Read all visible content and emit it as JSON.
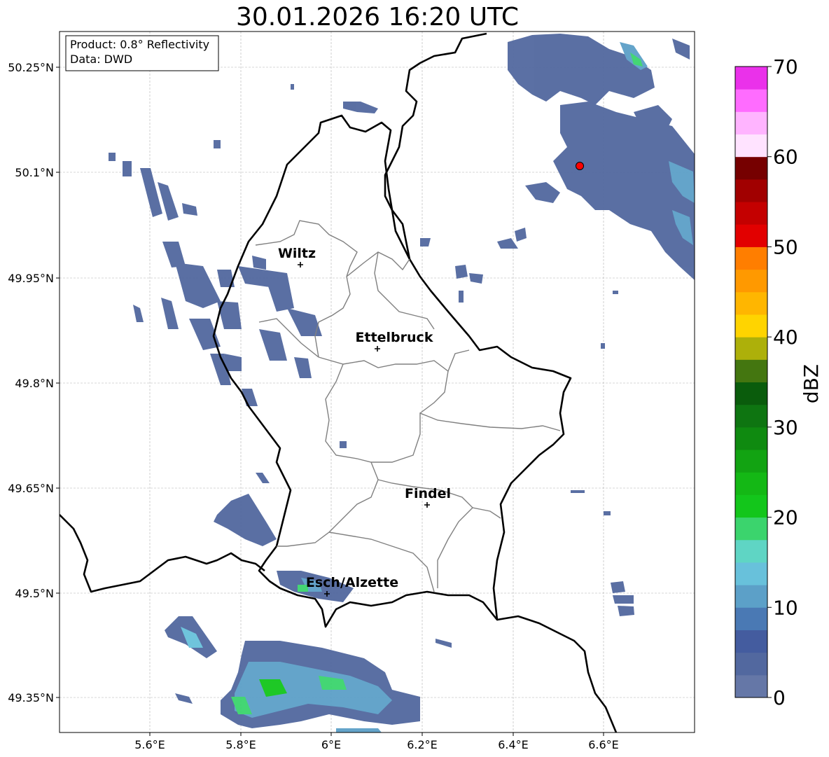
{
  "title": "30.01.2026 16:20 UTC",
  "info_box": {
    "product": "Product: 0.8° Reflectivity",
    "data": "Data: DWD"
  },
  "lat_labels": [
    "50.25°N",
    "50.1°N",
    "49.95°N",
    "49.8°N",
    "49.65°N",
    "49.5°N",
    "49.35°N"
  ],
  "lon_labels": [
    "5.6°E",
    "5.8°E",
    "6°E",
    "6.2°E",
    "6.4°E",
    "6.6°E"
  ],
  "cities": [
    {
      "name": "Wiltz",
      "lon": 5.935,
      "lat": 49.966
    },
    {
      "name": "Ettelbruck",
      "lon": 6.103,
      "lat": 49.848
    },
    {
      "name": "Findel",
      "lon": 6.213,
      "lat": 49.626
    },
    {
      "name": "Esch/Alzette",
      "lon": 5.981,
      "lat": 49.497
    }
  ],
  "radar_site": {
    "lon": 6.548,
    "lat": 50.109
  },
  "colorbar": {
    "label": "dBZ",
    "ticks": [
      "0",
      "10",
      "20",
      "30",
      "40",
      "50",
      "60",
      "70"
    ],
    "colors": [
      "#6577a7",
      "#52689f",
      "#445c9f",
      "#4a79b4",
      "#5ca0c8",
      "#68c1db",
      "#5fd5c4",
      "#3bd46d",
      "#13c61b",
      "#14b815",
      "#12a312",
      "#0f8a10",
      "#0e7511",
      "#0a5c0c",
      "#447610",
      "#adb00a",
      "#ffd400",
      "#ffb600",
      "#ff9900",
      "#ff7e00",
      "#e20000",
      "#c40000",
      "#a10000",
      "#760000",
      "#ffe3ff",
      "#ffb4ff",
      "#ff6cff",
      "#ea31ea"
    ]
  },
  "colors": {
    "border": "#000000",
    "canton": "#808080",
    "grid": "#b0b0b0",
    "radar_site": "#ff0000"
  }
}
